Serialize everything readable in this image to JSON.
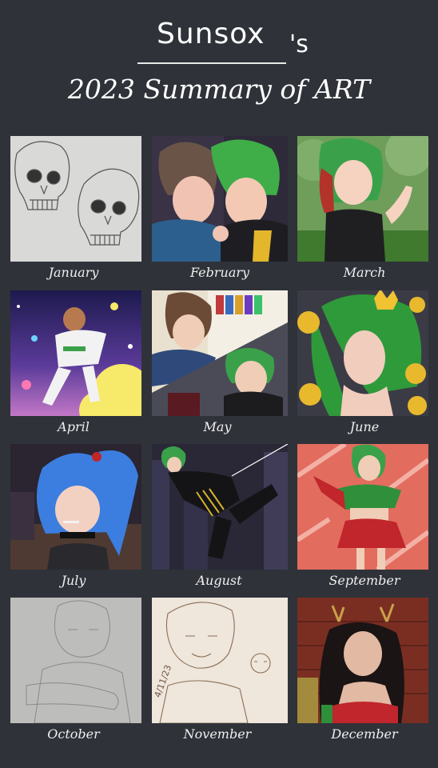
{
  "header": {
    "username": "Sunsox",
    "possessive": "'s",
    "title": "2023 Summary of ART"
  },
  "months": [
    {
      "label": "January",
      "subject": "skulls-sketch"
    },
    {
      "label": "February",
      "subject": "couple-hug"
    },
    {
      "label": "March",
      "subject": "green-haired-character"
    },
    {
      "label": "April",
      "subject": "space-floating"
    },
    {
      "label": "May",
      "subject": "two-panel-scene"
    },
    {
      "label": "June",
      "subject": "flower-crown-character"
    },
    {
      "label": "July",
      "subject": "blue-ponytail-character"
    },
    {
      "label": "August",
      "subject": "spider-hero"
    },
    {
      "label": "September",
      "subject": "strawberry-outfit"
    },
    {
      "label": "October",
      "subject": "pencil-sketch"
    },
    {
      "label": "November",
      "subject": "sepia-sketch"
    },
    {
      "label": "December",
      "subject": "antlers-character"
    }
  ],
  "november_sketch_date": "4/11/23"
}
